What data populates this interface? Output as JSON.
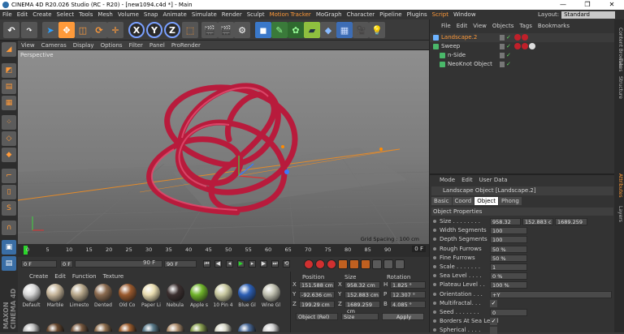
{
  "title": {
    "text": "CINEMA 4D R20.026 Studio (RC - R20) - [new1094.c4d *] - Main",
    "min": "—",
    "max": "❐",
    "close": "✕"
  },
  "menu": [
    "File",
    "Edit",
    "Create",
    "Select",
    "Tools",
    "Mesh",
    "Volume",
    "Snap",
    "Animate",
    "Simulate",
    "Render",
    "Sculpt",
    "Motion Tracker",
    "MoGraph",
    "Character",
    "Pipeline",
    "Plugins",
    "Script",
    "Window"
  ],
  "menu_highlight": [
    "Motion Tracker",
    "Script"
  ],
  "layout": {
    "label": "Layout:",
    "value": "Standard"
  },
  "viewport": {
    "menu": [
      "View",
      "Cameras",
      "Display",
      "Options",
      "Filter",
      "Panel",
      "ProRender"
    ],
    "name": "Perspective",
    "grid_spacing": "Grid Spacing : 100 cm"
  },
  "timeline": {
    "ticks": [
      "0",
      "5",
      "10",
      "15",
      "20",
      "25",
      "30",
      "35",
      "40",
      "45",
      "50",
      "55",
      "60",
      "65",
      "70",
      "75",
      "80",
      "85",
      "90"
    ],
    "current": "0 F"
  },
  "transport": {
    "start": "0 F",
    "current": "0 F",
    "end": "90 F",
    "end2": "90 F"
  },
  "materials": {
    "menu": [
      "Create",
      "Edit",
      "Function",
      "Texture"
    ],
    "items": [
      {
        "name": "Default",
        "color": "#d9d9d9"
      },
      {
        "name": "Marble",
        "color": "#c6b59a"
      },
      {
        "name": "Limesto",
        "color": "#b9a98c"
      },
      {
        "name": "Dented",
        "color": "#8a6a4f"
      },
      {
        "name": "Old Co",
        "color": "#9a5a2e"
      },
      {
        "name": "Paper Li",
        "color": "#e8dcb0"
      },
      {
        "name": "Nebula",
        "color": "#3b2f2f"
      },
      {
        "name": "Apple s",
        "color": "#6fb32a"
      },
      {
        "name": "10 Pin 4",
        "color": "#c9c9a0"
      },
      {
        "name": "Blue Gl",
        "color": "#2c5fb5"
      },
      {
        "name": "Wine Gl",
        "color": "#c0c0b0"
      }
    ],
    "row2_colors": [
      "#c0c0c0",
      "#6a4a30",
      "#7a5a40",
      "#907050",
      "#a06030",
      "#5a7a8a",
      "#b09070",
      "#8aa050",
      "#d8d8c8",
      "#4a6a9a",
      "#d0d0d0"
    ]
  },
  "coords": {
    "headers": [
      "Position",
      "Size",
      "Rotation"
    ],
    "rows": [
      {
        "axis": "X",
        "pos": "151.588 cm",
        "saxis": "X",
        "size": "958.32 cm",
        "raxis": "H",
        "rot": "1.825 °"
      },
      {
        "axis": "Y",
        "pos": "-92.636 cm",
        "saxis": "Y",
        "size": "152.883 cm",
        "raxis": "P",
        "rot": "12.307 °"
      },
      {
        "axis": "Z",
        "pos": "199.29 cm",
        "saxis": "Z",
        "size": "1689.259 cm",
        "raxis": "B",
        "rot": "4.085 °"
      }
    ],
    "mode": "Object (Rel)",
    "size_mode": "Size",
    "apply": "Apply"
  },
  "objects": {
    "tabs": [
      "File",
      "Edit",
      "View",
      "Objects",
      "Tags",
      "Bookmarks"
    ],
    "items": [
      {
        "name": "Landscape.2",
        "indent": 0,
        "selected": true
      },
      {
        "name": "Sweep",
        "indent": 0,
        "selected": false
      },
      {
        "name": "n-Side",
        "indent": 1,
        "selected": false
      },
      {
        "name": "NeoKnot Object",
        "indent": 1,
        "selected": false
      }
    ]
  },
  "attributes": {
    "menu": [
      "Mode",
      "Edit",
      "User Data"
    ],
    "header": "Landscape Object [Landscape.2]",
    "tabs": [
      "Basic",
      "Coord",
      "Object",
      "Phong"
    ],
    "active_tab": "Object",
    "section": "Object Properties",
    "props": [
      {
        "label": "Size . . . . . . . .",
        "v1": "958.32 cm",
        "v2": "152.883 c",
        "v3": "1689.259"
      },
      {
        "label": "Width Segments",
        "v1": "100"
      },
      {
        "label": "Depth Segments",
        "v1": "100"
      },
      {
        "label": "Rough Furrows",
        "v1": "50 %"
      },
      {
        "label": "Fine Furrows",
        "v1": "50 %"
      },
      {
        "label": "Scale . . . . . . .",
        "v1": "1"
      },
      {
        "label": "Sea Level . . . .",
        "v1": "0 %"
      },
      {
        "label": "Plateau Level . .",
        "v1": "100 %"
      },
      {
        "label": "Orientation . . .",
        "v1": "+Y"
      },
      {
        "label": "Multifractal. . .",
        "check": "✓"
      },
      {
        "label": "Seed . . . . . . .",
        "v1": "0"
      },
      {
        "label": "Borders At Sea Level",
        "check": "✓"
      },
      {
        "label": "Spherical . . . .",
        "check": ""
      }
    ]
  },
  "sidetabs": [
    "Content Browser",
    "Takes",
    "Structure",
    "Attributes",
    "Layers"
  ],
  "accent": "#ff9a3a"
}
